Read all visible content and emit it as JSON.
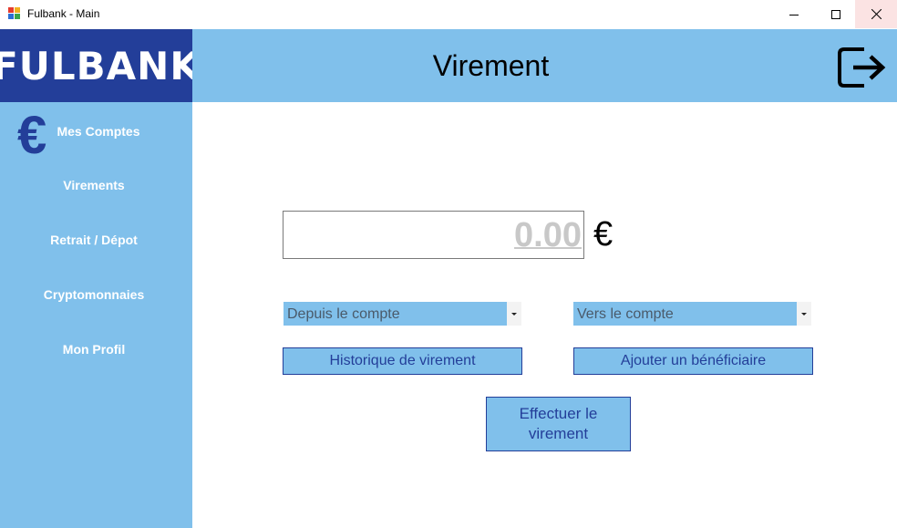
{
  "window": {
    "title": "Fulbank - Main",
    "controls": {
      "minimize": "minimize-icon",
      "maximize": "maximize-icon",
      "close": "close-icon"
    }
  },
  "header": {
    "logo": "FULBANK",
    "page_title": "Virement",
    "logout_icon": "logout-icon"
  },
  "sidebar": {
    "icon": "€",
    "items": [
      {
        "label": "Mes Comptes"
      },
      {
        "label": "Virements"
      },
      {
        "label": "Retrait / Dépot"
      },
      {
        "label": "Cryptomonnaies"
      },
      {
        "label": "Mon Profil"
      }
    ]
  },
  "transfer": {
    "amount": "0.00",
    "currency": "€",
    "from_account": "Depuis le compte",
    "to_account": "Vers le compte",
    "history_button": "Historique de virement",
    "add_beneficiary_button": "Ajouter un bénéficiaire",
    "confirm_button_line1": "Effectuer le",
    "confirm_button_line2": "virement"
  },
  "colors": {
    "brand_dark": "#233e99",
    "brand_light": "#80c0eb",
    "placeholder_gray": "#c8c8c8"
  }
}
